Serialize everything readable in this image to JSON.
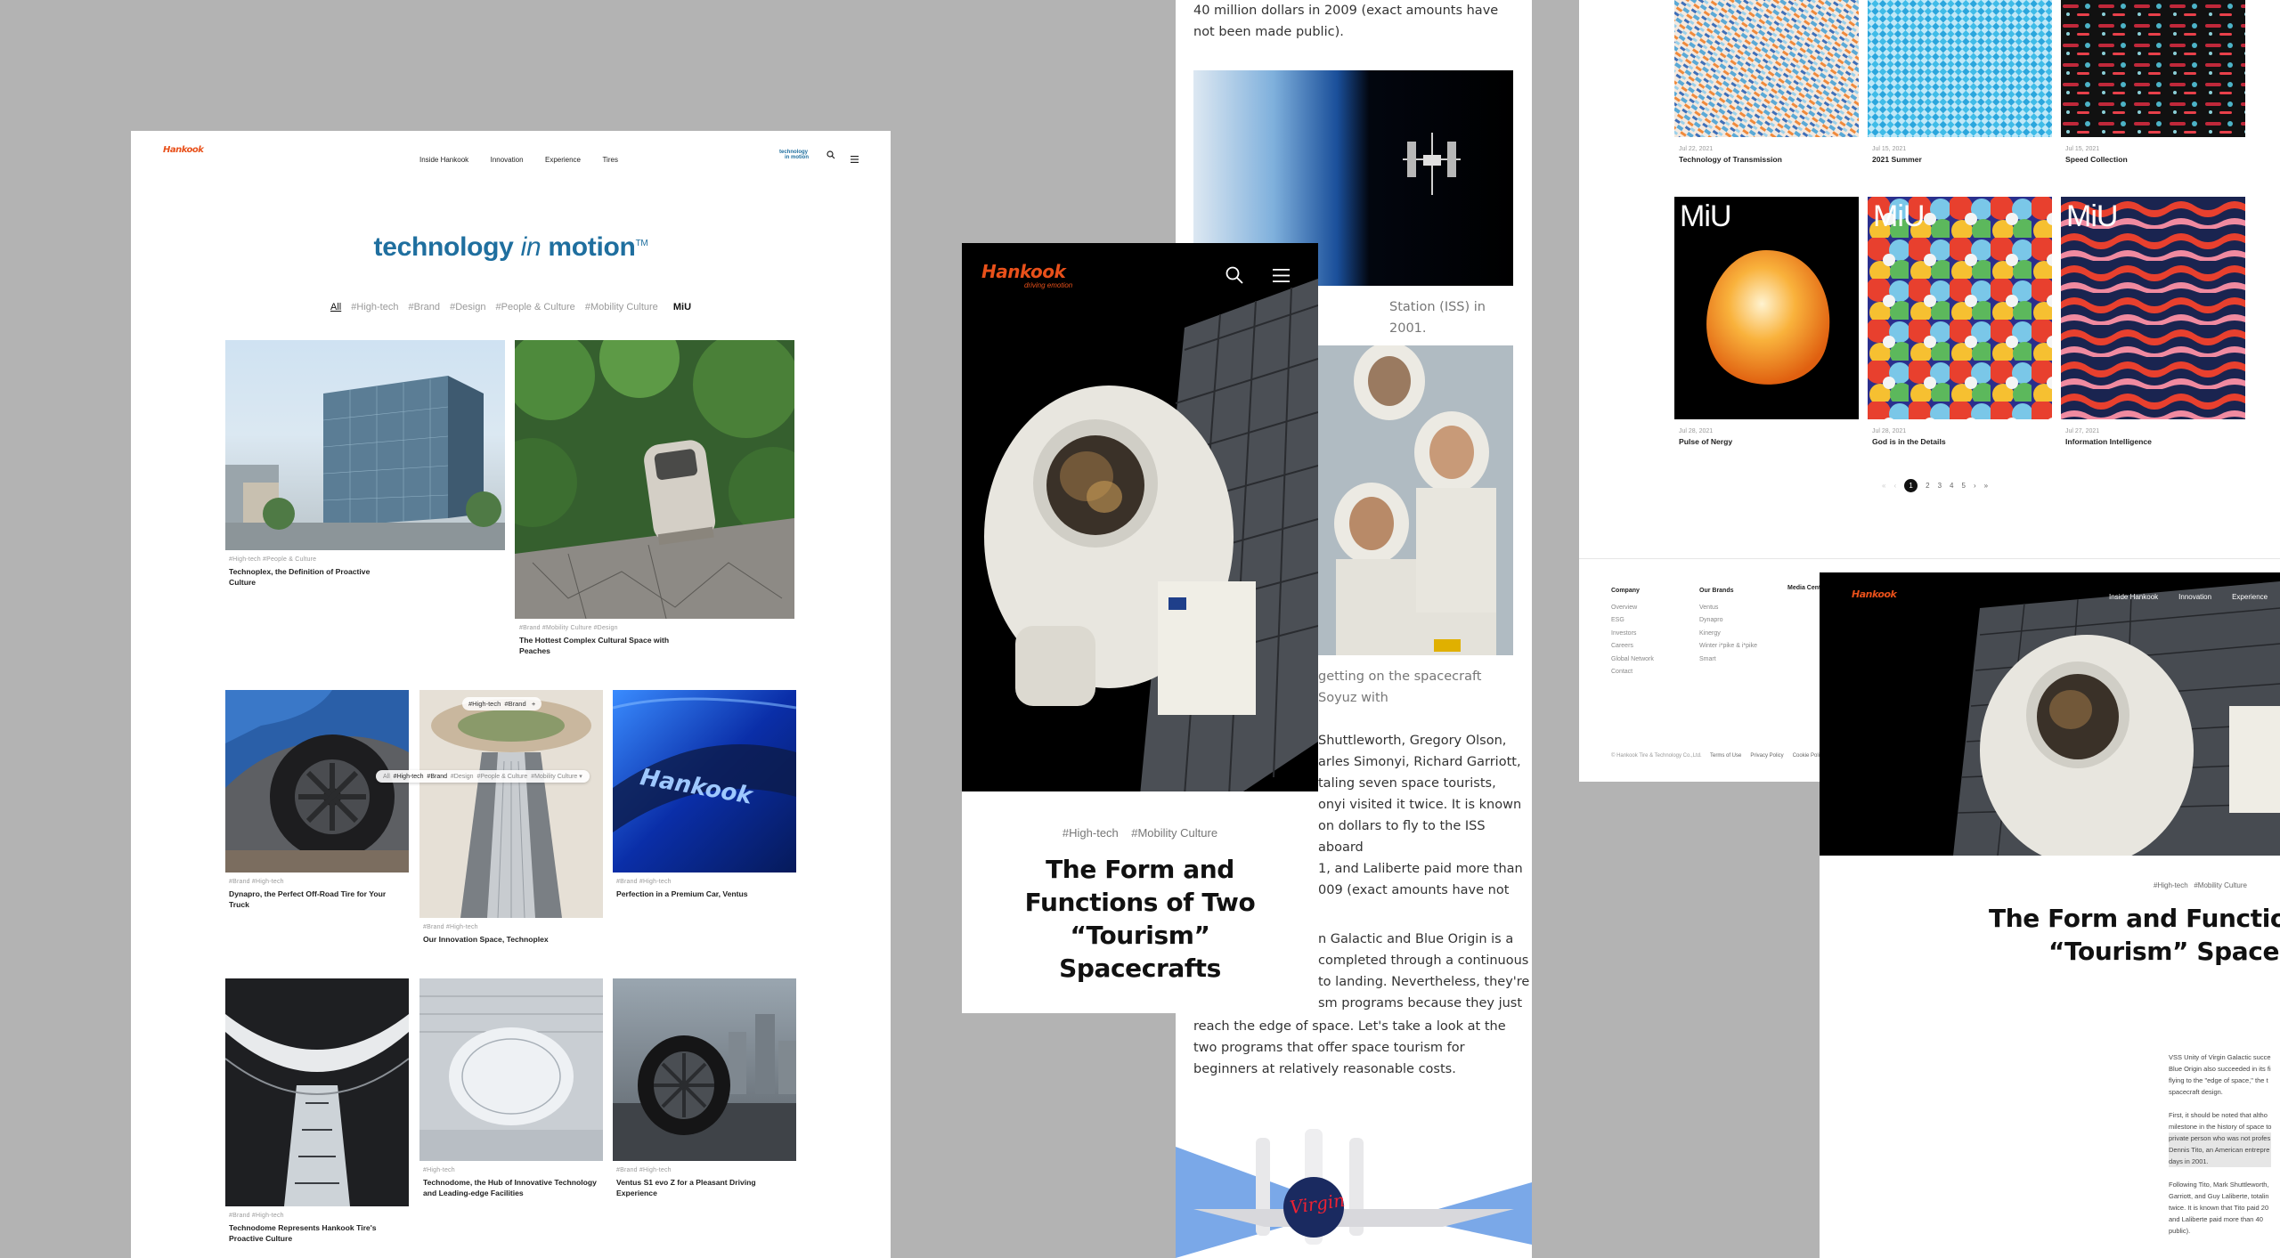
{
  "colors": {
    "brand_blue": "#1f6f9f",
    "hankook_orange": "#e8501a",
    "background": "#b3b3b3"
  },
  "brand": {
    "logo": "Hankook",
    "sub": "driving emotion"
  },
  "panelA": {
    "nav": [
      "Inside Hankook",
      "Innovation",
      "Experience",
      "Tires"
    ],
    "mini_logo_a": "technology",
    "mini_logo_b": "in motion",
    "title_a": "technology",
    "title_in": "in",
    "title_b": "motion",
    "title_tm": "TM",
    "filters": [
      "All",
      "#High-tech",
      "#Brand",
      "#Design",
      "#People & Culture",
      "#Mobility Culture"
    ],
    "filter_extra": "MiU",
    "cards": [
      {
        "tags": "#High-tech  #People & Culture",
        "title": "Technoplex, the Definition of Proactive Culture"
      },
      {
        "tags": "#Brand  #Mobility Culture  #Design",
        "title": "The Hottest Complex Cultural Space with Peaches"
      },
      {
        "tags": "#Brand  #High-tech",
        "title": "Dynapro, the Perfect Off-Road Tire for Your Truck"
      },
      {
        "tags": "#Brand  #High-tech",
        "title": "Our Innovation Space, Technoplex"
      },
      {
        "tags": "#Brand  #High-tech",
        "title": "Perfection in a Premium Car, Ventus"
      },
      {
        "tags": "#Brand  #High-tech",
        "title": "Technodome Represents Hankook Tire's Proactive Culture"
      },
      {
        "tags": "#High-tech",
        "title": "Technodome, the Hub of Innovative Technology and Leading-edge Facilities"
      },
      {
        "tags": "#Brand  #High-tech",
        "title": "Ventus S1 evo Z for a Pleasant Driving Experience"
      }
    ],
    "overlay_tags": [
      "#High-tech",
      "#Brand",
      "+"
    ],
    "overlay_filters": [
      "All",
      "#High-tech",
      "#Brand",
      "#Design",
      "#People & Culture",
      "#Mobility Culture"
    ]
  },
  "panelB": {
    "p1": "40 million dollars in 2009 (exact amounts have not been made public).",
    "p2": "Station (ISS) in 2001.",
    "p3": "getting on the spacecraft Soyuz with",
    "p4_lines": [
      "Shuttleworth, Gregory Olson,",
      "arles Simonyi, Richard Garriott,",
      "taling seven space tourists,",
      "onyi visited it twice. It is known",
      "on dollars to fly to the ISS aboard",
      "1, and Laliberte paid more than",
      "009 (exact amounts have not"
    ],
    "p5_lines": [
      "n Galactic and Blue Origin is a",
      "completed through a continuous",
      "to landing. Nevertheless, they're",
      "sm programs because they just"
    ],
    "p5_full": "reach the edge of space. Let's take a look at the two programs that offer space tourism for beginners at relatively reasonable costs.",
    "plane_text": "Virgin"
  },
  "panelC": {
    "tags": [
      "#High-tech",
      "#Mobility Culture"
    ],
    "title": "The Form and Functions of Two “Tourism” Spacecrafts"
  },
  "panelD": {
    "row1": [
      {
        "date": "Jul 22, 2021",
        "title": "Technology of Transmission"
      },
      {
        "date": "Jul 15, 2021",
        "title": "2021 Summer"
      },
      {
        "date": "Jul 15, 2021",
        "title": "Speed Collection"
      }
    ],
    "row2": [
      {
        "date": "Jul 28, 2021",
        "label": "MiU",
        "title": "Pulse of Nergy"
      },
      {
        "date": "Jul 28, 2021",
        "label": "MiU",
        "title": "God is in the Details"
      },
      {
        "date": "Jul 27, 2021",
        "label": "MiU",
        "title": "Information Intelligence"
      }
    ],
    "pagination": {
      "prev": "‹",
      "first": "«",
      "pages": [
        "1",
        "2",
        "3",
        "4",
        "5"
      ],
      "current": "1",
      "next": "›",
      "last": "»"
    },
    "footer": {
      "col1_title": "Company",
      "col1": [
        "Overview",
        "ESG",
        "Investors",
        "Careers",
        "Global Network",
        "Contact"
      ],
      "col2_title": "Our Brands",
      "col2": [
        "Ventus",
        "Dynapro",
        "Kinergy",
        "Winter i*pike & i*pike",
        "Smart"
      ],
      "col3_title": "Media Center",
      "copyright": "© Hankook Tire & Technology Co.,Ltd.",
      "links": [
        "Terms of Use",
        "Privacy Policy",
        "Cookie Policy"
      ]
    }
  },
  "panelE": {
    "nav": [
      "Inside Hankook",
      "Innovation",
      "Experience"
    ],
    "tags": [
      "#High-tech",
      "#Mobility Culture"
    ],
    "title_l1": "The Form and Functio",
    "title_l2": "“Tourism” Spacec",
    "body": [
      [
        "VSS Unity of Virgin Galactic succe",
        "Blue Origin also succeeded in its fi",
        "flying to the \"edge of space,\" the t",
        "spacecraft design."
      ],
      [
        "First, it should be noted that altho",
        "milestone in the history of space to",
        "private person who was not profes",
        "Dennis Tito, an American entrepre",
        "days in 2001."
      ],
      [
        "Following Tito, Mark Shuttleworth,",
        "Garriott, and Guy Laliberte, totalin",
        "twice. It is known that Tito paid 20",
        "and Laliberte paid more than 40",
        "public)."
      ]
    ]
  }
}
